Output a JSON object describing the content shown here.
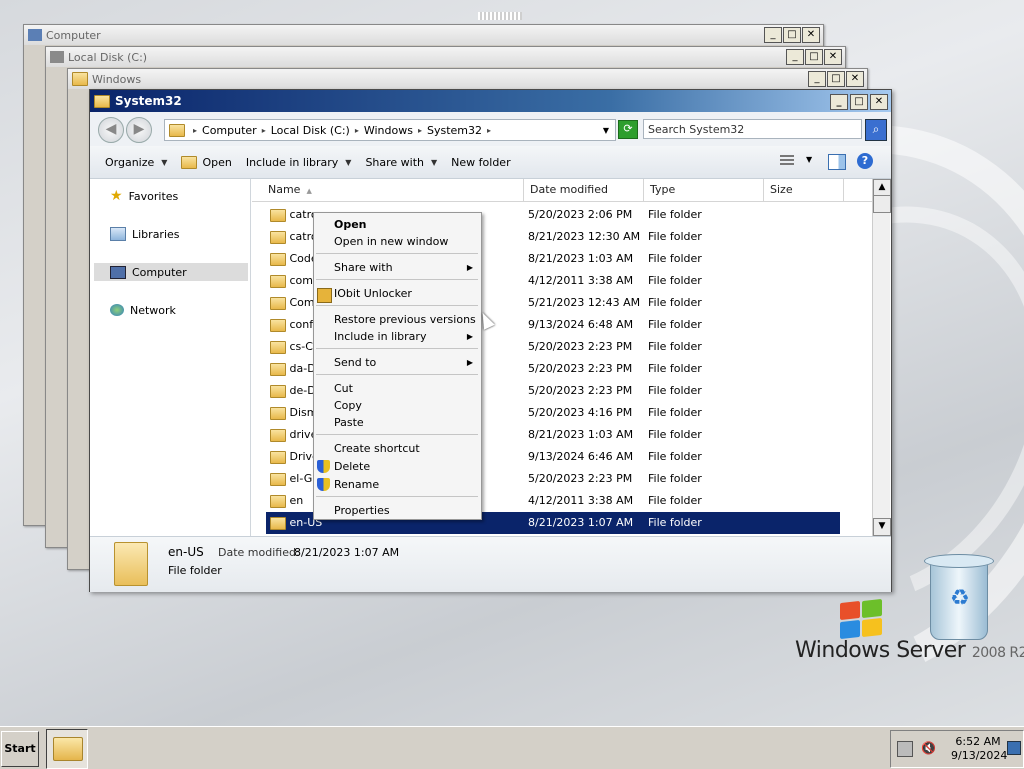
{
  "background_windows": [
    {
      "title": "Computer"
    },
    {
      "title": "Local Disk (C:)"
    },
    {
      "title": "Windows"
    }
  ],
  "window": {
    "title": "System32",
    "controls": {
      "minimize": "_",
      "maximize": "□",
      "close": "✕"
    }
  },
  "address": {
    "crumbs": [
      "Computer",
      "Local Disk (C:)",
      "Windows",
      "System32"
    ],
    "search_placeholder": "Search System32"
  },
  "command_bar": {
    "organize": "Organize",
    "open": "Open",
    "include_in_library": "Include in library",
    "share_with": "Share with",
    "new_folder": "New folder"
  },
  "nav": {
    "favorites": "Favorites",
    "libraries": "Libraries",
    "computer": "Computer",
    "network": "Network"
  },
  "columns": {
    "name": "Name",
    "date": "Date modified",
    "type": "Type",
    "size": "Size"
  },
  "files": [
    {
      "name": "catroot",
      "shown": "catro",
      "date": "5/20/2023 2:06 PM",
      "type": "File folder"
    },
    {
      "name": "catroot2",
      "shown": "catro",
      "date": "8/21/2023 12:30 AM",
      "type": "File folder"
    },
    {
      "name": "CodeIntegrity",
      "shown": "Code",
      "date": "8/21/2023 1:03 AM",
      "type": "File folder"
    },
    {
      "name": "com",
      "shown": "com",
      "date": "4/12/2011 3:38 AM",
      "type": "File folder"
    },
    {
      "name": "Components",
      "shown": "Comp",
      "date": "5/21/2023 12:43 AM",
      "type": "File folder"
    },
    {
      "name": "config",
      "shown": "confi",
      "date": "9/13/2024 6:48 AM",
      "type": "File folder"
    },
    {
      "name": "cs-CZ",
      "shown": "cs-CZ",
      "date": "5/20/2023 2:23 PM",
      "type": "File folder"
    },
    {
      "name": "da-DK",
      "shown": "da-D",
      "date": "5/20/2023 2:23 PM",
      "type": "File folder"
    },
    {
      "name": "de-DE",
      "shown": "de-D",
      "date": "5/20/2023 2:23 PM",
      "type": "File folder"
    },
    {
      "name": "Dism",
      "shown": "Dism",
      "date": "5/20/2023 4:16 PM",
      "type": "File folder"
    },
    {
      "name": "drivers",
      "shown": "drive",
      "date": "8/21/2023 1:03 AM",
      "type": "File folder"
    },
    {
      "name": "DriverStore",
      "shown": "Drive",
      "date": "9/13/2024 6:46 AM",
      "type": "File folder"
    },
    {
      "name": "el-GR",
      "shown": "el-GR",
      "date": "5/20/2023 2:23 PM",
      "type": "File folder"
    },
    {
      "name": "en",
      "shown": "en",
      "date": "4/12/2011 3:38 AM",
      "type": "File folder"
    },
    {
      "name": "en-US",
      "shown": "en-US",
      "date": "8/21/2023 1:07 AM",
      "type": "File folder"
    }
  ],
  "context_menu": {
    "open": "Open",
    "open_new_window": "Open in new window",
    "share_with": "Share with",
    "iobit": "IObit Unlocker",
    "restore": "Restore previous versions",
    "include": "Include in library",
    "send_to": "Send to",
    "cut": "Cut",
    "copy": "Copy",
    "paste": "Paste",
    "create_shortcut": "Create shortcut",
    "delete": "Delete",
    "rename": "Rename",
    "properties": "Properties"
  },
  "details": {
    "name": "en-US",
    "date_label": "Date modified:",
    "date_value": "8/21/2023 1:07 AM",
    "type": "File folder"
  },
  "desktop": {
    "brand": "Windows Server",
    "version": "2008 R2"
  },
  "taskbar": {
    "start": "Start",
    "time": "6:52 AM",
    "date": "9/13/2024"
  }
}
